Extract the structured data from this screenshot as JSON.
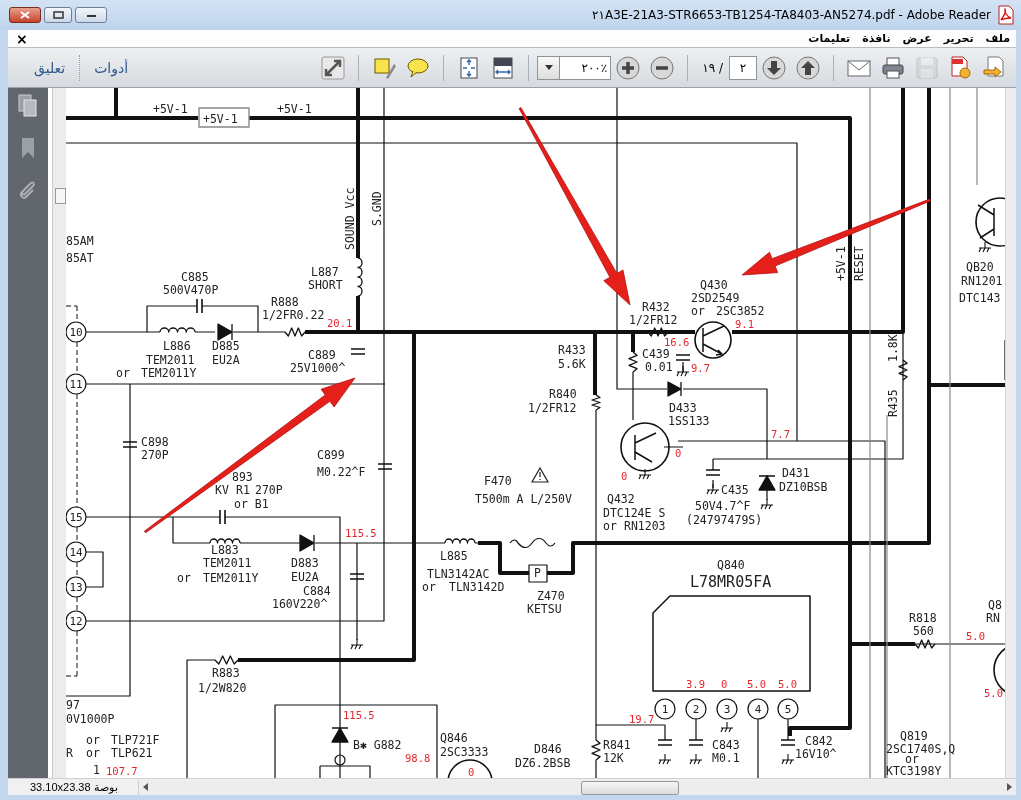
{
  "window": {
    "title": "٢١A3E-21A3-STR6653-TB1254-TA8403-AN5274.pdf - Adobe Reader"
  },
  "menu_bar": {
    "close_glyph": "×",
    "items": [
      "ملف",
      "تحرير",
      "عرض",
      "نافذة",
      "تعليمات"
    ]
  },
  "toolbar": {
    "comment": "تعليق",
    "tools": "أدوات",
    "zoom": "٢٠٠٪",
    "page": "٢",
    "page_count": "١٩ /",
    "save_button": {
      "disabled": true
    }
  },
  "document": {
    "labels": [
      {
        "text": "+5V-1",
        "kind": "label"
      },
      {
        "text": "+5V-1",
        "kind": "label"
      },
      {
        "text": "+5V-1",
        "kind": "label"
      },
      {
        "text": "SOUND Vcc",
        "kind": "vertical"
      },
      {
        "text": "S.GND",
        "kind": "vertical"
      },
      {
        "text": "85AM",
        "kind": "label"
      },
      {
        "text": "85AT",
        "kind": "label"
      },
      {
        "text": "C885",
        "kind": "label"
      },
      {
        "text": "500V470P",
        "kind": "label"
      },
      {
        "text": "L887",
        "kind": "label"
      },
      {
        "text": "SHORT",
        "kind": "label"
      },
      {
        "text": "R888",
        "kind": "label"
      },
      {
        "text": "1/2FR0.22",
        "kind": "label"
      },
      {
        "text": "20.1",
        "kind": "voltage"
      },
      {
        "text": "10",
        "kind": "pin"
      },
      {
        "text": "L886",
        "kind": "label"
      },
      {
        "text": "TEM2011",
        "kind": "label"
      },
      {
        "text": "D885",
        "kind": "label"
      },
      {
        "text": "EU2A",
        "kind": "label"
      },
      {
        "text": "C889",
        "kind": "label"
      },
      {
        "text": "25V1000^",
        "kind": "label"
      },
      {
        "text": "11",
        "kind": "pin"
      },
      {
        "text": "or",
        "kind": "label"
      },
      {
        "text": "TEM2011Y",
        "kind": "label"
      },
      {
        "text": "C898",
        "kind": "label"
      },
      {
        "text": "270P",
        "kind": "label"
      },
      {
        "text": "C899",
        "kind": "label"
      },
      {
        "text": "M0.22^F",
        "kind": "label"
      },
      {
        "text": "893",
        "kind": "label"
      },
      {
        "text": "KV",
        "kind": "label"
      },
      {
        "text": "R1",
        "kind": "label"
      },
      {
        "text": "270P",
        "kind": "label"
      },
      {
        "text": "or B1",
        "kind": "label"
      },
      {
        "text": "15",
        "kind": "pin"
      },
      {
        "text": "L883",
        "kind": "label"
      },
      {
        "text": "TEM2011",
        "kind": "label"
      },
      {
        "text": "or",
        "kind": "label"
      },
      {
        "text": "TEM2011Y",
        "kind": "label"
      },
      {
        "text": "D883",
        "kind": "label"
      },
      {
        "text": "EU2A",
        "kind": "label"
      },
      {
        "text": "115.5",
        "kind": "voltage"
      },
      {
        "text": "14",
        "kind": "pin"
      },
      {
        "text": "13",
        "kind": "pin"
      },
      {
        "text": "C884",
        "kind": "label"
      },
      {
        "text": "160V220^",
        "kind": "label"
      },
      {
        "text": "12",
        "kind": "pin"
      },
      {
        "text": "L885",
        "kind": "label"
      },
      {
        "text": "TLN3142AC",
        "kind": "label"
      },
      {
        "text": "or",
        "kind": "label"
      },
      {
        "text": "TLN3142D",
        "kind": "label"
      },
      {
        "text": "F470",
        "kind": "label"
      },
      {
        "text": "T500m A L/250V",
        "kind": "label"
      },
      {
        "text": "P",
        "kind": "label"
      },
      {
        "text": "Z470",
        "kind": "label"
      },
      {
        "text": "KETSU",
        "kind": "label"
      },
      {
        "text": "R883",
        "kind": "label"
      },
      {
        "text": "1/2W820",
        "kind": "label"
      },
      {
        "text": "97",
        "kind": "label"
      },
      {
        "text": "0V1000P",
        "kind": "label"
      },
      {
        "text": "or",
        "kind": "label"
      },
      {
        "text": "TLP721F",
        "kind": "label"
      },
      {
        "text": "R",
        "kind": "label"
      },
      {
        "text": "or",
        "kind": "label"
      },
      {
        "text": "TLP621",
        "kind": "label"
      },
      {
        "text": "1",
        "kind": "label"
      },
      {
        "text": "107.7",
        "kind": "voltage"
      },
      {
        "text": "115.5",
        "kind": "voltage"
      },
      {
        "text": "B✱ G882",
        "kind": "label"
      },
      {
        "text": "Q846",
        "kind": "label"
      },
      {
        "text": "2SC3333",
        "kind": "label"
      },
      {
        "text": "98.8",
        "kind": "voltage"
      },
      {
        "text": "0",
        "kind": "voltage"
      },
      {
        "text": "D846",
        "kind": "label"
      },
      {
        "text": "DZ6.2BSB",
        "kind": "label"
      },
      {
        "text": "R432",
        "kind": "label"
      },
      {
        "text": "1/2FR12",
        "kind": "label"
      },
      {
        "text": "Q430",
        "kind": "label"
      },
      {
        "text": "2SD2549",
        "kind": "label"
      },
      {
        "text": "or",
        "kind": "label"
      },
      {
        "text": "2SC3852",
        "kind": "label"
      },
      {
        "text": "9.1",
        "kind": "voltage"
      },
      {
        "text": "16.6",
        "kind": "voltage"
      },
      {
        "text": "R433",
        "kind": "label"
      },
      {
        "text": "5.6K",
        "kind": "label"
      },
      {
        "text": "C439",
        "kind": "label"
      },
      {
        "text": "0.01",
        "kind": "label"
      },
      {
        "text": "9.7",
        "kind": "voltage"
      },
      {
        "text": "R840",
        "kind": "label"
      },
      {
        "text": "1/2FR12",
        "kind": "label"
      },
      {
        "text": "D433",
        "kind": "label"
      },
      {
        "text": "1SS133",
        "kind": "label"
      },
      {
        "text": "7.7",
        "kind": "voltage"
      },
      {
        "text": "+5V-1",
        "kind": "vertical"
      },
      {
        "text": "RESET",
        "kind": "vertical"
      },
      {
        "text": "1.8K",
        "kind": "vertical"
      },
      {
        "text": "R435",
        "kind": "vertical"
      },
      {
        "text": "QB20",
        "kind": "label"
      },
      {
        "text": "RN1201",
        "kind": "label"
      },
      {
        "text": "DTC143",
        "kind": "label"
      },
      {
        "text": "0",
        "kind": "voltage"
      },
      {
        "text": "0",
        "kind": "voltage"
      },
      {
        "text": "Q432",
        "kind": "label"
      },
      {
        "text": "DTC124E S",
        "kind": "label"
      },
      {
        "text": "or",
        "kind": "label"
      },
      {
        "text": "RN1203",
        "kind": "label"
      },
      {
        "text": "C435",
        "kind": "label"
      },
      {
        "text": "50V4.7^F",
        "kind": "label"
      },
      {
        "text": "(24797479S)",
        "kind": "label"
      },
      {
        "text": "D431",
        "kind": "label"
      },
      {
        "text": "DZ10BSB",
        "kind": "label"
      },
      {
        "text": "Q840",
        "kind": "label"
      },
      {
        "text": "L78MR05FA",
        "kind": "part"
      },
      {
        "text": "3.9",
        "kind": "voltage"
      },
      {
        "text": "0",
        "kind": "voltage"
      },
      {
        "text": "5.0",
        "kind": "voltage"
      },
      {
        "text": "5.0",
        "kind": "voltage"
      },
      {
        "text": "1",
        "kind": "pin"
      },
      {
        "text": "2",
        "kind": "pin"
      },
      {
        "text": "3",
        "kind": "pin"
      },
      {
        "text": "4",
        "kind": "pin"
      },
      {
        "text": "5",
        "kind": "pin"
      },
      {
        "text": "19.7",
        "kind": "voltage"
      },
      {
        "text": "R841",
        "kind": "label"
      },
      {
        "text": "12K",
        "kind": "label"
      },
      {
        "text": "C843",
        "kind": "label"
      },
      {
        "text": "M0.1",
        "kind": "label"
      },
      {
        "text": "C842",
        "kind": "label"
      },
      {
        "text": "16V10^",
        "kind": "label"
      },
      {
        "text": "R818",
        "kind": "label"
      },
      {
        "text": "560",
        "kind": "label"
      },
      {
        "text": "5.0",
        "kind": "voltage"
      },
      {
        "text": "Q8",
        "kind": "label"
      },
      {
        "text": "RN",
        "kind": "label"
      },
      {
        "text": "5.0",
        "kind": "voltage"
      },
      {
        "text": "Q819",
        "kind": "label"
      },
      {
        "text": "2SC1740S,Q",
        "kind": "label"
      },
      {
        "text": "or",
        "kind": "label"
      },
      {
        "text": "KTC3198Y",
        "kind": "label"
      }
    ]
  },
  "status_bar": {
    "page_size": "33.10x23.38 بوصة"
  }
}
